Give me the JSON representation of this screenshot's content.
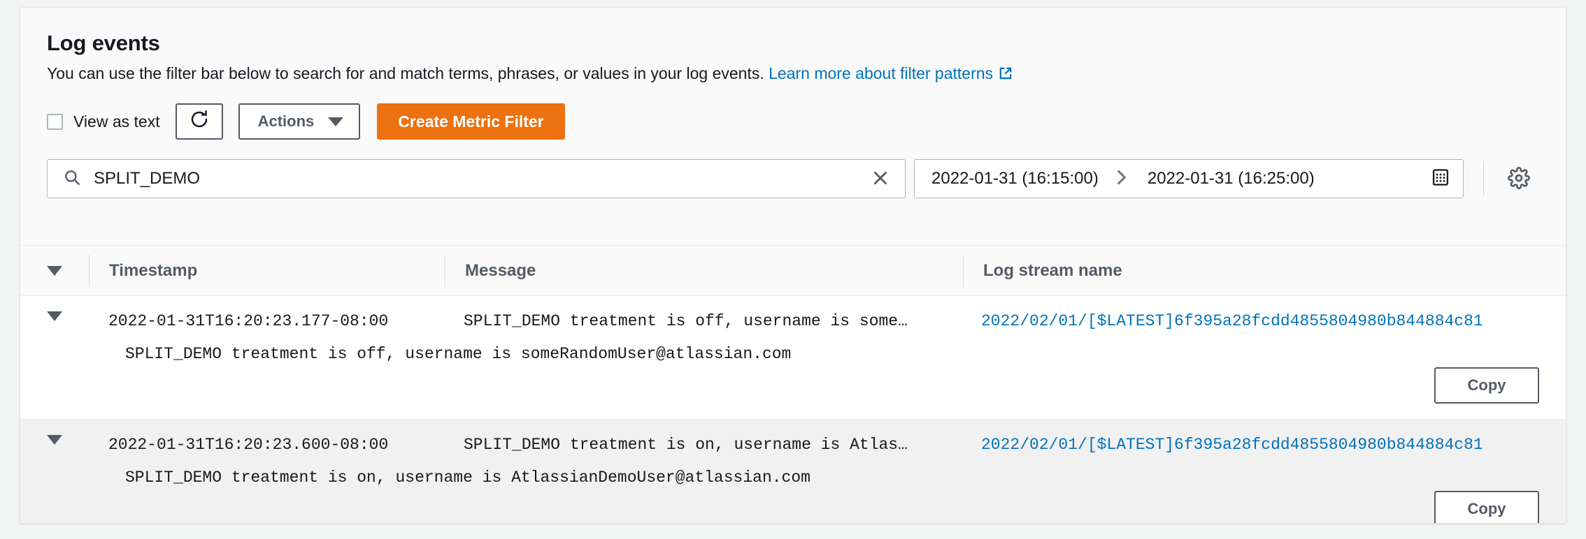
{
  "panel": {
    "title": "Log events",
    "description": "You can use the filter bar below to search for and match terms, phrases, or values in your log events.",
    "learn_more_link": "Learn more about filter patterns",
    "external_link_icon": "external-link-icon"
  },
  "toolbar": {
    "view_as_text_label": "View as text",
    "view_as_text_checked": false,
    "refresh_icon": "refresh-icon",
    "actions_label": "Actions",
    "actions_caret_icon": "chevron-down-icon",
    "create_metric_filter_label": "Create Metric Filter",
    "primary_color": "#ec7211"
  },
  "filter": {
    "search_icon": "search-icon",
    "search_value": "SPLIT_DEMO",
    "search_placeholder": "Filter events",
    "clear_icon": "close-icon",
    "date_start": "2022-01-31 (16:15:00)",
    "date_separator_icon": "chevron-right-icon",
    "date_end": "2022-01-31 (16:25:00)",
    "calendar_icon": "calendar-icon",
    "settings_icon": "gear-icon"
  },
  "table": {
    "sort_caret_icon": "caret-down-icon",
    "columns": [
      "Timestamp",
      "Message",
      "Log stream name"
    ],
    "rows": [
      {
        "expand_icon": "caret-down-icon",
        "timestamp": "2022-01-31T16:20:23.177-08:00",
        "message": "SPLIT_DEMO treatment is off, username is some…",
        "log_stream": "2022/02/01/[$LATEST]6f395a28fcdd4855804980b844884c81",
        "expanded_message": "SPLIT_DEMO treatment is off, username is someRandomUser@atlassian.com",
        "copy_label": "Copy"
      },
      {
        "expand_icon": "caret-down-icon",
        "timestamp": "2022-01-31T16:20:23.600-08:00",
        "message": "SPLIT_DEMO treatment is on, username is Atlas…",
        "log_stream": "2022/02/01/[$LATEST]6f395a28fcdd4855804980b844884c81",
        "expanded_message": "SPLIT_DEMO treatment is on, username is AtlassianDemoUser@atlassian.com",
        "copy_label": "Copy"
      }
    ]
  },
  "colors": {
    "link": "#0073bb",
    "accent": "#ec7211",
    "text": "#16191f",
    "muted": "#545b64"
  }
}
